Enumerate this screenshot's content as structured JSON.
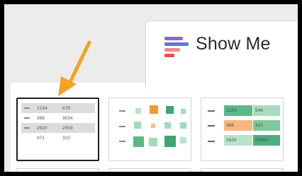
{
  "header": {
    "title": "Show Me",
    "icon": "show-me-bars-icon",
    "icon_colors": [
      "#8a6fb0",
      "#5b7bd1",
      "#f08a8a",
      "#e2523f"
    ]
  },
  "pointer": {
    "icon": "arrow-pointer-icon",
    "color": "#f5a123"
  },
  "chart_types": [
    {
      "name": "text table",
      "selected": true,
      "rows": [
        [
          "1234",
          "678"
        ],
        [
          "368",
          "3034"
        ],
        [
          "2620",
          "2558"
        ],
        [
          "971",
          "322"
        ]
      ]
    },
    {
      "name": "heat map",
      "selected": false,
      "accent_colors": [
        "#f29a2e",
        "#3fa572",
        "#9fdcb8"
      ]
    },
    {
      "name": "highlight table",
      "selected": false,
      "rows": [
        [
          "1234",
          "546"
        ],
        [
          "368",
          "310"
        ],
        [
          "2620",
          "53690"
        ]
      ],
      "highlight_color": "#f6b87e"
    }
  ]
}
